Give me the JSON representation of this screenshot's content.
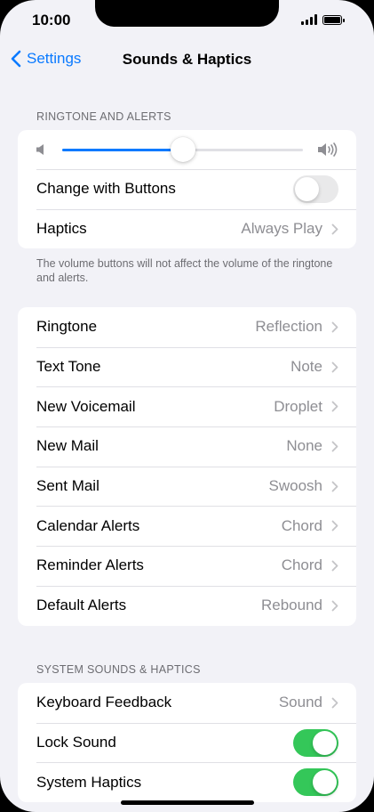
{
  "status": {
    "time": "10:00"
  },
  "nav": {
    "back_label": "Settings",
    "title": "Sounds & Haptics"
  },
  "ringtone_section": {
    "header": "RINGTONE AND ALERTS",
    "volume_level": 0.5,
    "change_with_buttons": {
      "label": "Change with Buttons",
      "enabled": false
    },
    "haptics": {
      "label": "Haptics",
      "value": "Always Play"
    },
    "footer": "The volume buttons will not affect the volume of the ringtone and alerts."
  },
  "tones": [
    {
      "label": "Ringtone",
      "value": "Reflection"
    },
    {
      "label": "Text Tone",
      "value": "Note"
    },
    {
      "label": "New Voicemail",
      "value": "Droplet"
    },
    {
      "label": "New Mail",
      "value": "None"
    },
    {
      "label": "Sent Mail",
      "value": "Swoosh"
    },
    {
      "label": "Calendar Alerts",
      "value": "Chord"
    },
    {
      "label": "Reminder Alerts",
      "value": "Chord"
    },
    {
      "label": "Default Alerts",
      "value": "Rebound"
    }
  ],
  "system_section": {
    "header": "SYSTEM SOUNDS & HAPTICS",
    "keyboard_feedback": {
      "label": "Keyboard Feedback",
      "value": "Sound"
    },
    "lock_sound": {
      "label": "Lock Sound",
      "enabled": true
    },
    "system_haptics": {
      "label": "System Haptics",
      "enabled": true
    }
  },
  "colors": {
    "accent": "#0a7aff",
    "toggle_on": "#34c759",
    "background": "#f2f2f7"
  }
}
